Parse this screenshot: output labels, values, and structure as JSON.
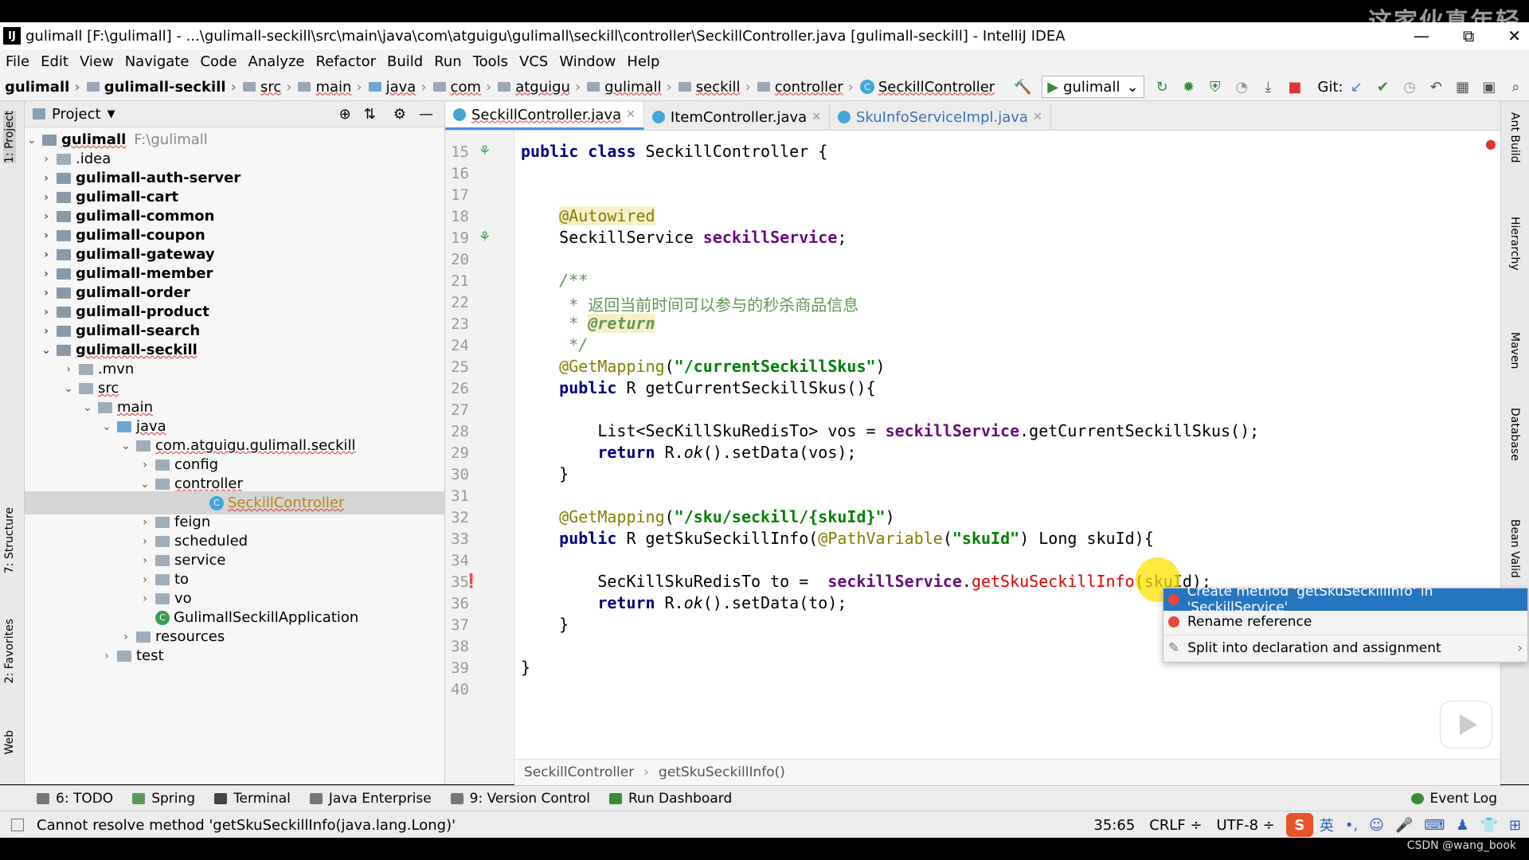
{
  "watermark": "这家伙真年轻",
  "window": {
    "title": "gulimall [F:\\gulimall] - ...\\gulimall-seckill\\src\\main\\java\\com\\atguigu\\gulimall\\seckill\\controller\\SeckillController.java [gulimall-seckill] - IntelliJ IDEA",
    "minimize": "—",
    "restore": "⧉",
    "close": "✕"
  },
  "menu": [
    "File",
    "Edit",
    "View",
    "Navigate",
    "Code",
    "Analyze",
    "Refactor",
    "Build",
    "Run",
    "Tools",
    "VCS",
    "Window",
    "Help"
  ],
  "breadcrumbs": [
    "gulimall",
    "gulimall-seckill",
    "src",
    "main",
    "java",
    "com",
    "atguigu",
    "gulimall",
    "seckill",
    "controller",
    "SeckillController"
  ],
  "toolbar": {
    "run_config": "gulimall",
    "git_label": "Git:"
  },
  "project_panel": {
    "title": "Project",
    "root": {
      "name": "gulimall",
      "path": "F:\\gulimall"
    },
    "items": [
      {
        "label": ".idea"
      },
      {
        "label": "gulimall-auth-server"
      },
      {
        "label": "gulimall-cart"
      },
      {
        "label": "gulimall-common"
      },
      {
        "label": "gulimall-coupon"
      },
      {
        "label": "gulimall-gateway"
      },
      {
        "label": "gulimall-member"
      },
      {
        "label": "gulimall-order"
      },
      {
        "label": "gulimall-product"
      },
      {
        "label": "gulimall-search"
      },
      {
        "label": "gulimall-seckill"
      },
      {
        "label": ".mvn"
      },
      {
        "label": "src"
      },
      {
        "label": "main"
      },
      {
        "label": "java"
      },
      {
        "label": "com.atguigu.gulimall.seckill"
      },
      {
        "label": "config"
      },
      {
        "label": "controller"
      },
      {
        "label": "SeckillController"
      },
      {
        "label": "feign"
      },
      {
        "label": "scheduled"
      },
      {
        "label": "service"
      },
      {
        "label": "to"
      },
      {
        "label": "vo"
      },
      {
        "label": "GulimallSeckillApplication"
      },
      {
        "label": "resources"
      },
      {
        "label": "test"
      }
    ]
  },
  "left_tabs": [
    "1: Project",
    "7: Structure",
    "2: Favorites",
    "Web"
  ],
  "right_tabs": [
    "Ant Build",
    "Hierarchy",
    "Maven",
    "Database",
    "Bean Valid"
  ],
  "editor_tabs": [
    "SeckillController.java",
    "ItemController.java",
    "SkuInfoServiceImpl.java"
  ],
  "editor_lines": [
    "15",
    "16",
    "17",
    "18",
    "19",
    "20",
    "21",
    "22",
    "23",
    "24",
    "25",
    "26",
    "27",
    "28",
    "29",
    "30",
    "31",
    "32",
    "33",
    "34",
    "35",
    "36",
    "37",
    "38",
    "39",
    "40"
  ],
  "editor_breadcrumb": [
    "SeckillController",
    "getSkuSeckillInfo()"
  ],
  "intention_popup": [
    "Create method 'getSkuSeckillInfo' in 'SeckillService'",
    "Rename reference",
    "Split into declaration and assignment"
  ],
  "tool_windows": [
    "6: TODO",
    "Spring",
    "Terminal",
    "Java Enterprise",
    "9: Version Control",
    "Run Dashboard",
    "Event Log"
  ],
  "status": {
    "message": "Cannot resolve method 'getSkuSeckillInfo(java.lang.Long)'",
    "position": "35:65",
    "line_sep": "CRLF ÷",
    "encoding": "UTF-8 ÷"
  },
  "csdn": "CSDN @wang_book"
}
